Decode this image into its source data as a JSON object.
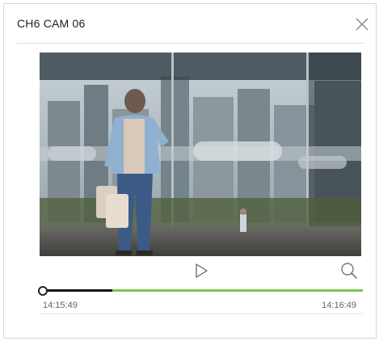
{
  "dialog": {
    "title": "CH6 CAM 06",
    "close_icon": "close-icon"
  },
  "player": {
    "play_icon": "play-icon",
    "zoom_icon": "zoom-icon",
    "start_time": "14:15:49",
    "end_time": "14:16:49",
    "played_fraction": 0.22,
    "colors": {
      "played": "#141414",
      "available": "#7cc452"
    }
  }
}
